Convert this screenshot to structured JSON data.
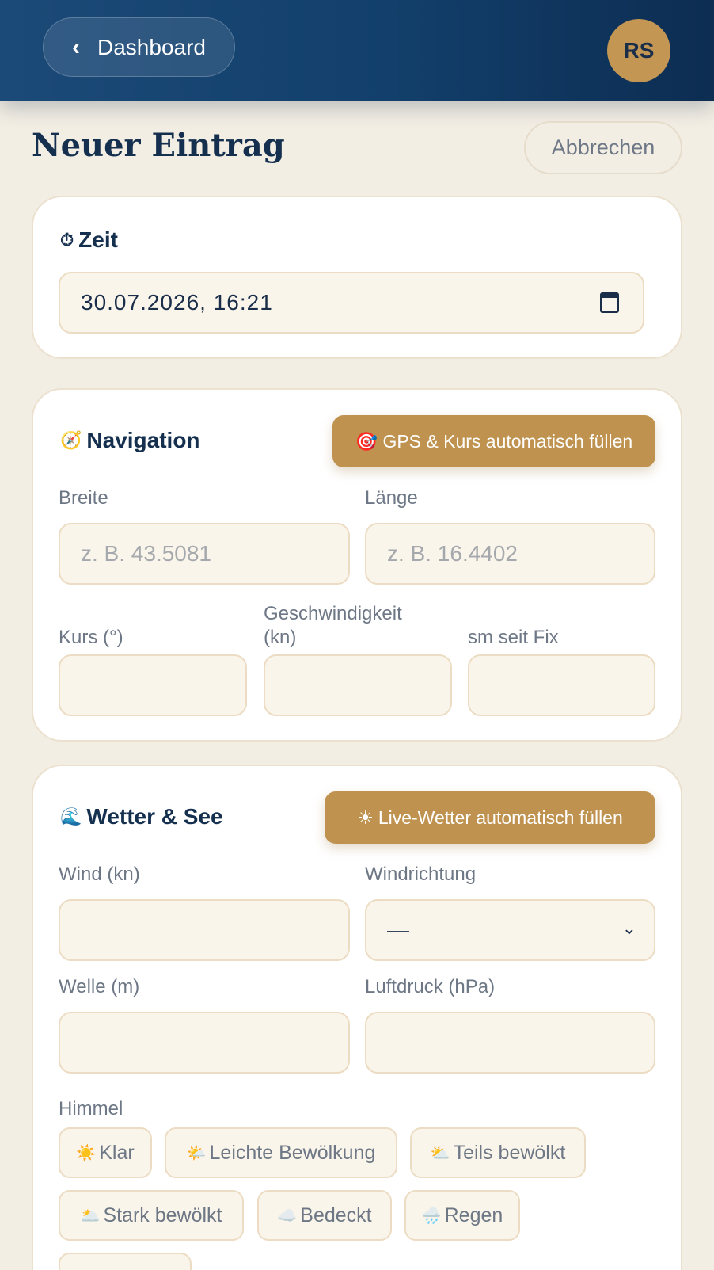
{
  "header": {
    "back_label": "Dashboard",
    "avatar_initials": "RS"
  },
  "page": {
    "title": "Neuer Eintrag",
    "cancel_label": "Abbrechen"
  },
  "zeit": {
    "title": "Zeit",
    "datetime_value": "30.07.2026, 16:21"
  },
  "navigation": {
    "title": "Navigation",
    "autofill_label": "GPS & Kurs automatisch füllen",
    "lat_label": "Breite",
    "lat_placeholder": "z. B. 43.5081",
    "lon_label": "Länge",
    "lon_placeholder": "z. B. 16.4402",
    "course_label": "Kurs (°)",
    "speed_label": "Geschwindigkeit (kn)",
    "distance_label": "sm seit Fix"
  },
  "weather": {
    "title": "Wetter & See",
    "autofill_label": "Live-Wetter automatisch füllen",
    "wind_label": "Wind (kn)",
    "direction_label": "Windrichtung",
    "direction_value": "—",
    "wave_label": "Welle (m)",
    "pressure_label": "Luftdruck (hPa)",
    "sky_label": "Himmel",
    "sky_options": [
      {
        "label": "Klar",
        "icon": "☀️"
      },
      {
        "label": "Leichte Bewölkung",
        "icon": "🌤️"
      },
      {
        "label": "Teils bewölkt",
        "icon": "⛅"
      },
      {
        "label": "Stark bewölkt",
        "icon": "🌥️"
      },
      {
        "label": "Bedeckt",
        "icon": "☁️"
      },
      {
        "label": "Regen",
        "icon": "🌧️"
      }
    ]
  },
  "colors": {
    "header": "#123f6b",
    "accent_gold": "#bf934f",
    "background": "#f3eee4",
    "field_bg": "#faf5ea"
  }
}
